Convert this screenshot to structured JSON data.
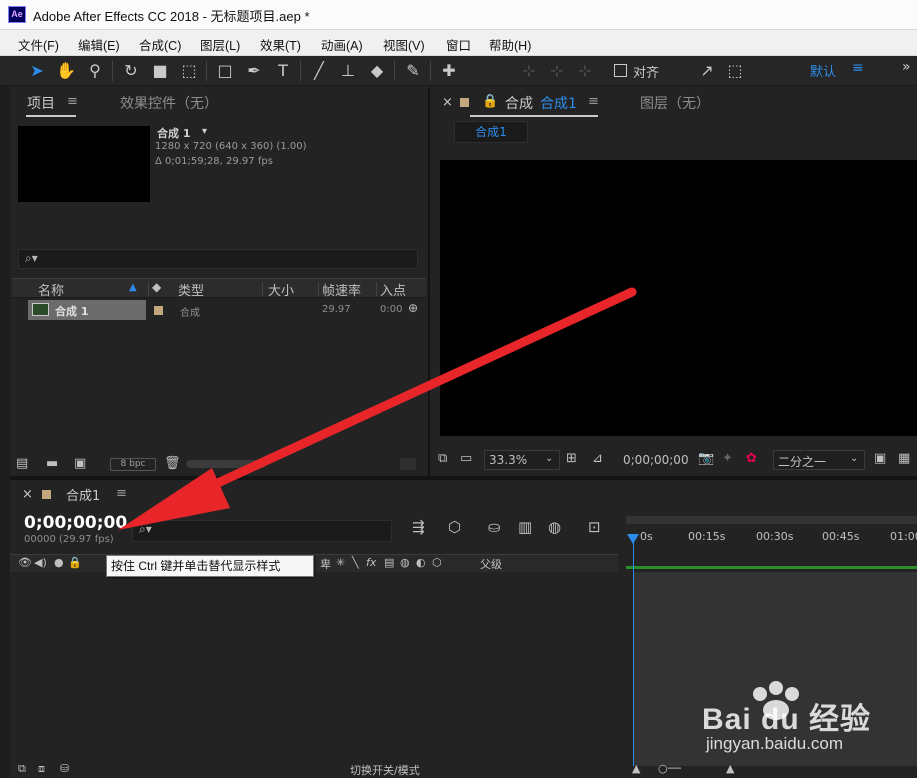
{
  "window": {
    "title": "Adobe After Effects CC 2018 - 无标题项目.aep *",
    "logo_text": "Ae"
  },
  "menu": [
    "文件(F)",
    "编辑(E)",
    "合成(C)",
    "图层(L)",
    "效果(T)",
    "动画(A)",
    "视图(V)",
    "窗口",
    "帮助(H)"
  ],
  "toolbar": {
    "snap_label": "对齐",
    "workspace": "默认",
    "workspace_menu": "≡",
    "overflow": "»"
  },
  "project_panel": {
    "tab_project": "项目",
    "tab_effect_controls": "效果控件（无）",
    "selected_item": {
      "name": "合成 1",
      "dimensions": "1280 x 720  (640 x 360) (1.00)",
      "duration": "Δ 0;01;59;28, 29.97 fps"
    },
    "search_glyph": "⌕▾",
    "columns": [
      "名称",
      "类型",
      "大小",
      "帧速率",
      "入点"
    ],
    "rows": [
      {
        "name": "合成 1",
        "type": "合成",
        "size": "",
        "fps": "29.97",
        "in_point": "0:00"
      }
    ],
    "footer_bpc": "8 bpc",
    "label_color": "#c2a77f"
  },
  "viewer_panel": {
    "tab_composition": "合成",
    "tab_composition_name": "合成1",
    "tab_layer": "图层（无）",
    "subtab": "合成1",
    "zoom": "33.3%",
    "timecode": "0;00;00;00",
    "resolution": "二分之一"
  },
  "timeline_panel": {
    "tab": "合成1",
    "timecode": "0;00;00;00",
    "frames_fps": "00000 (29.97 fps)",
    "search_glyph": "⌕▾",
    "ruler_ticks": [
      "0s",
      "00:15s",
      "00:30s",
      "00:45s",
      "01:00"
    ],
    "parent_label": "父级",
    "footer_toggle": "切换开关/模式",
    "tooltip": "按住 Ctrl 键并单击替代显示样式"
  },
  "watermark": {
    "brand": "Bai du 经验",
    "url": "jingyan.baidu.com"
  },
  "colors": {
    "accent": "#2d8ceb",
    "arrow": "#e8262a",
    "panel_bg": "#232323",
    "work_area": "#2a8f2a"
  }
}
